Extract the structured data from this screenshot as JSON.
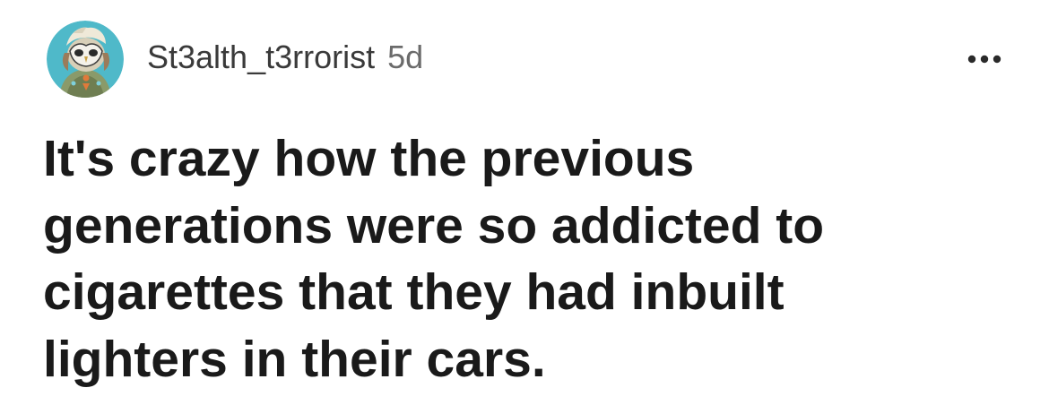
{
  "post": {
    "author": {
      "username": "St3alth_t3rrorist",
      "avatar_icon": "owl-mask-avatar"
    },
    "age": "5d",
    "more_icon": "more-options-icon",
    "title_lines": [
      "It's crazy how the previous",
      "generations were so addicted to",
      "cigarettes that they had inbuilt",
      "lighters in their cars."
    ]
  },
  "colors": {
    "avatar_background": "#4fb9c9",
    "username": "#3a3a3a",
    "age": "#6b6b6b",
    "title": "#1a1a1a",
    "background": "#ffffff"
  }
}
